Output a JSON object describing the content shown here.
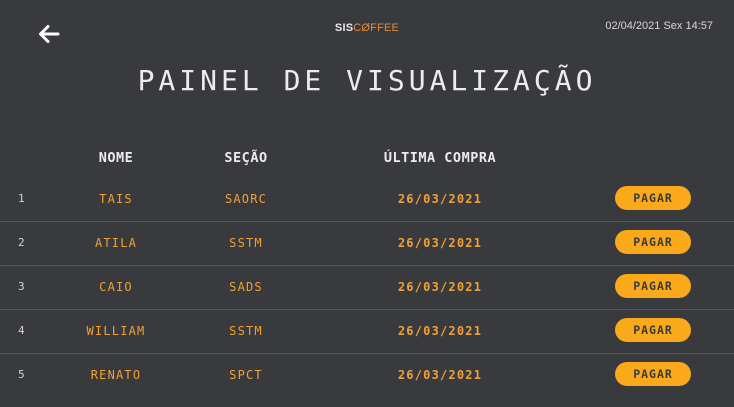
{
  "header": {
    "brand_part1": "SIS",
    "brand_part2": "CØFFEE",
    "datetime": "02/04/2021 Sex 14:57"
  },
  "title": "PAINEL DE VISUALIZAÇÃO",
  "table": {
    "columns": {
      "nome": "NOME",
      "secao": "SEÇÃO",
      "ultima_compra": "ÚLTIMA COMPRA"
    },
    "pay_label": "PAGAR",
    "rows": [
      {
        "num": "1",
        "nome": "TAIS",
        "secao": "SAORC",
        "data": "26/03/2021"
      },
      {
        "num": "2",
        "nome": "ATILA",
        "secao": "SSTM",
        "data": "26/03/2021"
      },
      {
        "num": "3",
        "nome": "CAIO",
        "secao": "SADS",
        "data": "26/03/2021"
      },
      {
        "num": "4",
        "nome": "WILLIAM",
        "secao": "SSTM",
        "data": "26/03/2021"
      },
      {
        "num": "5",
        "nome": "RENATO",
        "secao": "SPCT",
        "data": "26/03/2021"
      }
    ]
  },
  "colors": {
    "background": "#393a3e",
    "accent_orange": "#f0a135",
    "button_yellow": "#f9a91a",
    "brand_orange": "#e58a3c"
  },
  "icons": {
    "back": "arrow-left-icon"
  }
}
